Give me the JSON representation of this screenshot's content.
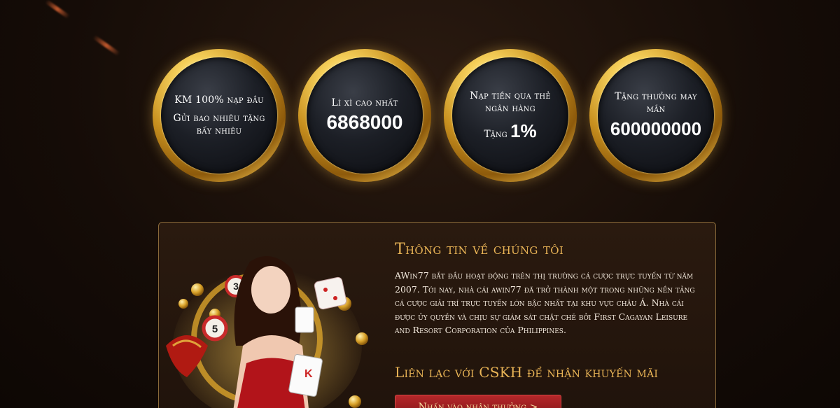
{
  "promos": [
    {
      "line1": "KM 100% nạp đầu",
      "line2": "Gửi bao nhiêu tặng bấy nhiêu"
    },
    {
      "label": "Lì xì cao nhất",
      "value": "6868000"
    },
    {
      "label": "Nạp tiền qua thẻ ngân hàng",
      "prefix": "Tặng",
      "value": "1%"
    },
    {
      "label": "Tặng thưởng may mắn",
      "value": "600000000"
    }
  ],
  "about": {
    "title": "Thông tin về chúng tôi",
    "body": "AWin77 bắt đầu hoạt động trên thị trường cá cược trực tuyến từ năm 2007. Tới nay, nhà cái awin77 đã trở thành một trong những nền tảng cá cược giải trí trực tuyến lớn bậc nhất tại khu vực châu Á. Nhà cái được ủy quyền và chịu sự giám sát chặt chẽ bởi First Cagayan Leisure and Resort Corporation của Philippines.",
    "contact_title": "Liên lạc với CSKH để nhận khuyến mãi",
    "cta_label": "Nhấn vào nhận thưởng  >"
  }
}
